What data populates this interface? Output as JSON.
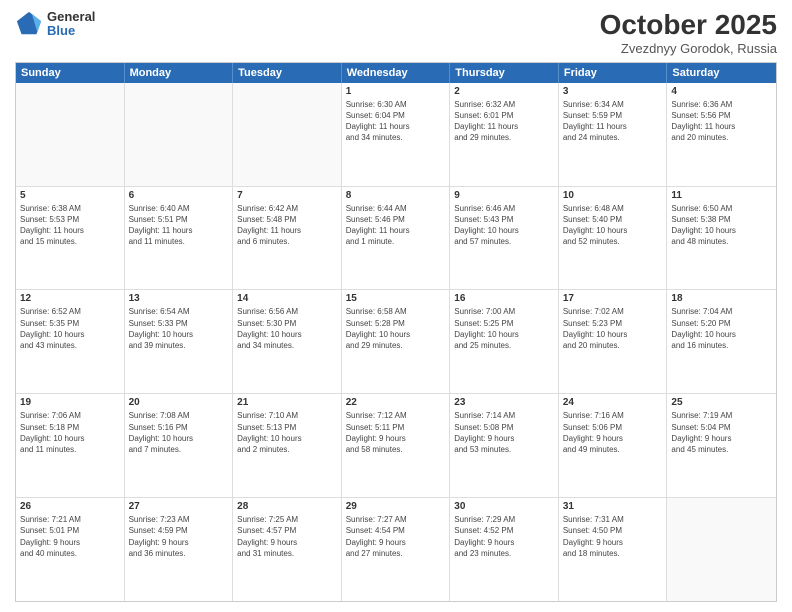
{
  "logo": {
    "general": "General",
    "blue": "Blue"
  },
  "title": "October 2025",
  "subtitle": "Zvezdnyy Gorodok, Russia",
  "header_days": [
    "Sunday",
    "Monday",
    "Tuesday",
    "Wednesday",
    "Thursday",
    "Friday",
    "Saturday"
  ],
  "rows": [
    [
      {
        "day": "",
        "lines": [],
        "empty": true
      },
      {
        "day": "",
        "lines": [],
        "empty": true
      },
      {
        "day": "",
        "lines": [],
        "empty": true
      },
      {
        "day": "1",
        "lines": [
          "Sunrise: 6:30 AM",
          "Sunset: 6:04 PM",
          "Daylight: 11 hours",
          "and 34 minutes."
        ]
      },
      {
        "day": "2",
        "lines": [
          "Sunrise: 6:32 AM",
          "Sunset: 6:01 PM",
          "Daylight: 11 hours",
          "and 29 minutes."
        ]
      },
      {
        "day": "3",
        "lines": [
          "Sunrise: 6:34 AM",
          "Sunset: 5:59 PM",
          "Daylight: 11 hours",
          "and 24 minutes."
        ]
      },
      {
        "day": "4",
        "lines": [
          "Sunrise: 6:36 AM",
          "Sunset: 5:56 PM",
          "Daylight: 11 hours",
          "and 20 minutes."
        ]
      }
    ],
    [
      {
        "day": "5",
        "lines": [
          "Sunrise: 6:38 AM",
          "Sunset: 5:53 PM",
          "Daylight: 11 hours",
          "and 15 minutes."
        ]
      },
      {
        "day": "6",
        "lines": [
          "Sunrise: 6:40 AM",
          "Sunset: 5:51 PM",
          "Daylight: 11 hours",
          "and 11 minutes."
        ]
      },
      {
        "day": "7",
        "lines": [
          "Sunrise: 6:42 AM",
          "Sunset: 5:48 PM",
          "Daylight: 11 hours",
          "and 6 minutes."
        ]
      },
      {
        "day": "8",
        "lines": [
          "Sunrise: 6:44 AM",
          "Sunset: 5:46 PM",
          "Daylight: 11 hours",
          "and 1 minute."
        ]
      },
      {
        "day": "9",
        "lines": [
          "Sunrise: 6:46 AM",
          "Sunset: 5:43 PM",
          "Daylight: 10 hours",
          "and 57 minutes."
        ]
      },
      {
        "day": "10",
        "lines": [
          "Sunrise: 6:48 AM",
          "Sunset: 5:40 PM",
          "Daylight: 10 hours",
          "and 52 minutes."
        ]
      },
      {
        "day": "11",
        "lines": [
          "Sunrise: 6:50 AM",
          "Sunset: 5:38 PM",
          "Daylight: 10 hours",
          "and 48 minutes."
        ]
      }
    ],
    [
      {
        "day": "12",
        "lines": [
          "Sunrise: 6:52 AM",
          "Sunset: 5:35 PM",
          "Daylight: 10 hours",
          "and 43 minutes."
        ]
      },
      {
        "day": "13",
        "lines": [
          "Sunrise: 6:54 AM",
          "Sunset: 5:33 PM",
          "Daylight: 10 hours",
          "and 39 minutes."
        ]
      },
      {
        "day": "14",
        "lines": [
          "Sunrise: 6:56 AM",
          "Sunset: 5:30 PM",
          "Daylight: 10 hours",
          "and 34 minutes."
        ]
      },
      {
        "day": "15",
        "lines": [
          "Sunrise: 6:58 AM",
          "Sunset: 5:28 PM",
          "Daylight: 10 hours",
          "and 29 minutes."
        ]
      },
      {
        "day": "16",
        "lines": [
          "Sunrise: 7:00 AM",
          "Sunset: 5:25 PM",
          "Daylight: 10 hours",
          "and 25 minutes."
        ]
      },
      {
        "day": "17",
        "lines": [
          "Sunrise: 7:02 AM",
          "Sunset: 5:23 PM",
          "Daylight: 10 hours",
          "and 20 minutes."
        ]
      },
      {
        "day": "18",
        "lines": [
          "Sunrise: 7:04 AM",
          "Sunset: 5:20 PM",
          "Daylight: 10 hours",
          "and 16 minutes."
        ]
      }
    ],
    [
      {
        "day": "19",
        "lines": [
          "Sunrise: 7:06 AM",
          "Sunset: 5:18 PM",
          "Daylight: 10 hours",
          "and 11 minutes."
        ]
      },
      {
        "day": "20",
        "lines": [
          "Sunrise: 7:08 AM",
          "Sunset: 5:16 PM",
          "Daylight: 10 hours",
          "and 7 minutes."
        ]
      },
      {
        "day": "21",
        "lines": [
          "Sunrise: 7:10 AM",
          "Sunset: 5:13 PM",
          "Daylight: 10 hours",
          "and 2 minutes."
        ]
      },
      {
        "day": "22",
        "lines": [
          "Sunrise: 7:12 AM",
          "Sunset: 5:11 PM",
          "Daylight: 9 hours",
          "and 58 minutes."
        ]
      },
      {
        "day": "23",
        "lines": [
          "Sunrise: 7:14 AM",
          "Sunset: 5:08 PM",
          "Daylight: 9 hours",
          "and 53 minutes."
        ]
      },
      {
        "day": "24",
        "lines": [
          "Sunrise: 7:16 AM",
          "Sunset: 5:06 PM",
          "Daylight: 9 hours",
          "and 49 minutes."
        ]
      },
      {
        "day": "25",
        "lines": [
          "Sunrise: 7:19 AM",
          "Sunset: 5:04 PM",
          "Daylight: 9 hours",
          "and 45 minutes."
        ]
      }
    ],
    [
      {
        "day": "26",
        "lines": [
          "Sunrise: 7:21 AM",
          "Sunset: 5:01 PM",
          "Daylight: 9 hours",
          "and 40 minutes."
        ]
      },
      {
        "day": "27",
        "lines": [
          "Sunrise: 7:23 AM",
          "Sunset: 4:59 PM",
          "Daylight: 9 hours",
          "and 36 minutes."
        ]
      },
      {
        "day": "28",
        "lines": [
          "Sunrise: 7:25 AM",
          "Sunset: 4:57 PM",
          "Daylight: 9 hours",
          "and 31 minutes."
        ]
      },
      {
        "day": "29",
        "lines": [
          "Sunrise: 7:27 AM",
          "Sunset: 4:54 PM",
          "Daylight: 9 hours",
          "and 27 minutes."
        ]
      },
      {
        "day": "30",
        "lines": [
          "Sunrise: 7:29 AM",
          "Sunset: 4:52 PM",
          "Daylight: 9 hours",
          "and 23 minutes."
        ]
      },
      {
        "day": "31",
        "lines": [
          "Sunrise: 7:31 AM",
          "Sunset: 4:50 PM",
          "Daylight: 9 hours",
          "and 18 minutes."
        ]
      },
      {
        "day": "",
        "lines": [],
        "empty": true
      }
    ]
  ]
}
